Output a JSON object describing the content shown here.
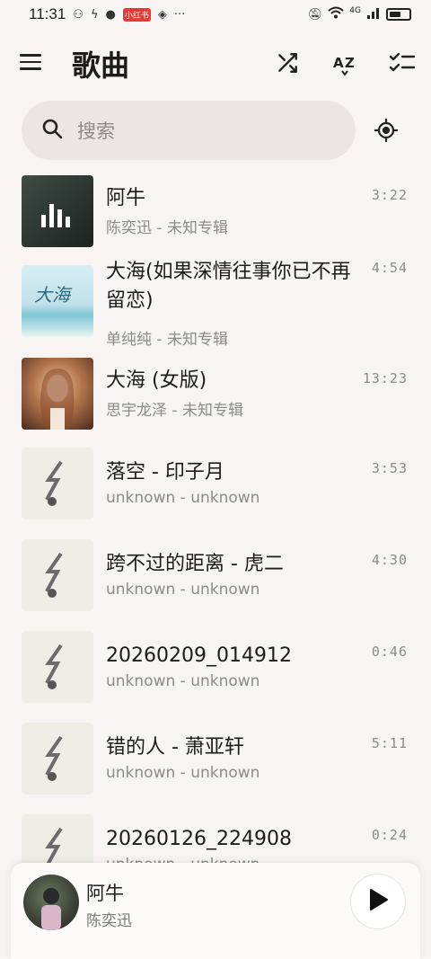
{
  "status_bar": {
    "time": "11:31",
    "badge": "小红书",
    "more": "···",
    "network": "4G"
  },
  "app_bar": {
    "title": "歌曲",
    "menu_icon": "menu-icon",
    "shuffle_icon": "shuffle-icon",
    "sort_icon": "sort-az-icon",
    "select_icon": "checklist-icon"
  },
  "search": {
    "placeholder": "搜索"
  },
  "songs": [
    {
      "title": "阿牛",
      "subtitle": "陈奕迅 - 未知专辑",
      "duration": "3:22",
      "cover": "now-playing"
    },
    {
      "title": "大海(如果深情往事你已不再留恋)",
      "subtitle": "单纯纯 - 未知专辑",
      "duration": "4:54",
      "cover": "sea"
    },
    {
      "title": "大海 (女版)",
      "subtitle": "思宇龙泽 - 未知专辑",
      "duration": "13:23",
      "cover": "portrait"
    },
    {
      "title": "落空 - 印子月",
      "subtitle": "unknown - unknown",
      "duration": "3:53",
      "cover": "default"
    },
    {
      "title": "跨不过的距离 - 虎二",
      "subtitle": "unknown - unknown",
      "duration": "4:30",
      "cover": "default"
    },
    {
      "title": "20260209_014912",
      "subtitle": "unknown - unknown",
      "duration": "0:46",
      "cover": "default"
    },
    {
      "title": "错的人 - 萧亚轩",
      "subtitle": "unknown - unknown",
      "duration": "5:11",
      "cover": "default"
    },
    {
      "title": "20260126_224908",
      "subtitle": "unknown - unknown",
      "duration": "0:24",
      "cover": "default"
    }
  ],
  "now_playing": {
    "title": "阿牛",
    "artist": "陈奕迅",
    "play_icon": "play-icon"
  },
  "colors": {
    "background": "#f8f4f3",
    "search_bg": "#ebe5e4",
    "secondary_text": "#8e8a8a"
  }
}
